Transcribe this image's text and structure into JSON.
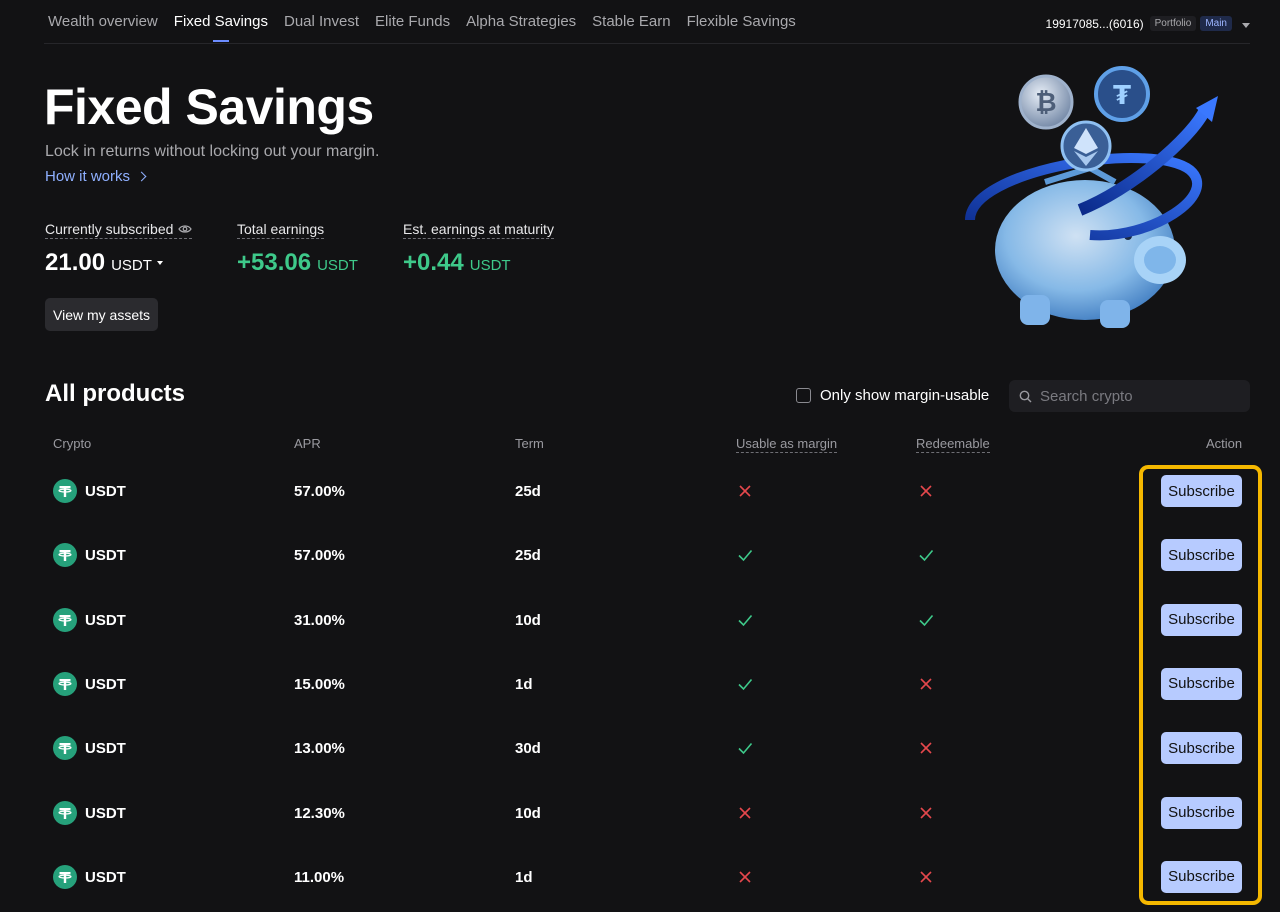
{
  "nav": {
    "tabs": [
      {
        "label": "Wealth overview",
        "active": false
      },
      {
        "label": "Fixed Savings",
        "active": true
      },
      {
        "label": "Dual Invest",
        "active": false
      },
      {
        "label": "Elite Funds",
        "active": false
      },
      {
        "label": "Alpha Strategies",
        "active": false
      },
      {
        "label": "Stable Earn",
        "active": false
      },
      {
        "label": "Flexible Savings",
        "active": false
      }
    ],
    "account_id": "19917085...(6016)",
    "badge_portfolio": "Portfolio",
    "badge_main": "Main"
  },
  "hero": {
    "title": "Fixed Savings",
    "subtitle": "Lock in returns without locking out your margin.",
    "how_it_works": "How it works",
    "stats": {
      "subscribed_label": "Currently subscribed",
      "subscribed_value": "21.00",
      "subscribed_unit": "USDT",
      "earnings_label": "Total earnings",
      "earnings_value": "+53.06",
      "earnings_unit": "USDT",
      "maturity_label": "Est. earnings at maturity",
      "maturity_value": "+0.44",
      "maturity_unit": "USDT"
    },
    "view_assets": "View my assets"
  },
  "products": {
    "title": "All products",
    "filter_label": "Only show margin-usable",
    "search_placeholder": "Search crypto",
    "columns": {
      "crypto": "Crypto",
      "apr": "APR",
      "term": "Term",
      "margin": "Usable as margin",
      "redeemable": "Redeemable",
      "action": "Action"
    },
    "rows": [
      {
        "symbol": "USDT",
        "apr": "57.00%",
        "term": "25d",
        "margin": false,
        "redeemable": false,
        "action": "Subscribe"
      },
      {
        "symbol": "USDT",
        "apr": "57.00%",
        "term": "25d",
        "margin": true,
        "redeemable": true,
        "action": "Subscribe"
      },
      {
        "symbol": "USDT",
        "apr": "31.00%",
        "term": "10d",
        "margin": true,
        "redeemable": true,
        "action": "Subscribe"
      },
      {
        "symbol": "USDT",
        "apr": "15.00%",
        "term": "1d",
        "margin": true,
        "redeemable": false,
        "action": "Subscribe"
      },
      {
        "symbol": "USDT",
        "apr": "13.00%",
        "term": "30d",
        "margin": true,
        "redeemable": false,
        "action": "Subscribe"
      },
      {
        "symbol": "USDT",
        "apr": "12.30%",
        "term": "10d",
        "margin": false,
        "redeemable": false,
        "action": "Subscribe"
      },
      {
        "symbol": "USDT",
        "apr": "11.00%",
        "term": "1d",
        "margin": false,
        "redeemable": false,
        "action": "Subscribe"
      }
    ]
  },
  "colors": {
    "background": "#121214",
    "accent_blue": "#b7cbff",
    "positive_green": "#3ec98a",
    "negative_red": "#e5484d",
    "highlight": "#f5b800",
    "tether_green": "#26a17b"
  },
  "icons": {
    "check": "check-icon",
    "cross": "cross-icon",
    "coin": "tether-coin-icon",
    "search": "search-icon",
    "eye": "eye-icon"
  }
}
